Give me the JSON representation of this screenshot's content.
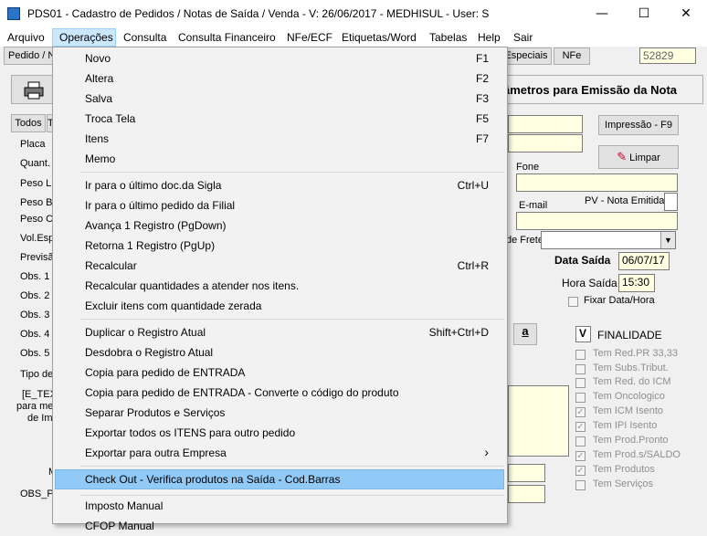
{
  "window": {
    "title": "PDS01 - Cadastro de Pedidos / Notas de Saída / Venda - V: 26/06/2017 - MEDHISUL - User: S",
    "minimize_glyph": "—",
    "maximize_glyph": "☐",
    "close_glyph": "✕"
  },
  "menubar": [
    "Arquivo",
    "Operações",
    "Consulta",
    "Consulta Financeiro",
    "NFe/ECF",
    "Etiquetas/Word",
    "Tabelas",
    "Help",
    "Sair"
  ],
  "form": {
    "tab_pedido": "Pedido / N",
    "btn_especiais": "Especiais",
    "btn_nfe": "NFe",
    "record_number": "52829",
    "banner": "âmetros para Emissão da Nota",
    "btn_todos": "Todos",
    "btn_t": "T",
    "btn_impressao": "Impressão - F9",
    "btn_limpar": "Limpar",
    "left_labels": [
      "Placa",
      "Quant. V",
      "Peso Lí",
      "Peso Br",
      "Peso Cu",
      "Vol.Esp",
      "Previsã",
      "Obs. 1",
      "Obs. 2",
      "Obs. 3",
      "Obs. 4",
      "Obs. 5",
      "Tipo de"
    ],
    "e_text_lines": [
      "[E_TEX",
      "para me",
      "de Imp"
    ],
    "label_m": "M",
    "label_obs_p": "OBS_P",
    "label_fone": "Fone",
    "label_email": "E-mail",
    "label_pv": "PV - Nota Emitida",
    "label_frete": "de Frete",
    "label_data_saida": "Data Saída",
    "data_saida": "06/07/17",
    "label_hora_saida": "Hora Saída",
    "hora_saida": "15:30",
    "label_fixar": "Fixar Data/Hora",
    "finalidade_value": "V",
    "finalidade_label": "FINALIDADE",
    "checkboxes": [
      {
        "label": "Tem Red.PR 33,33",
        "checked": false
      },
      {
        "label": "Tem Subs.Tribut.",
        "checked": false
      },
      {
        "label": "Tem Red. do ICM",
        "checked": false
      },
      {
        "label": "Tem Oncologico",
        "checked": false
      },
      {
        "label": "Tem ICM Isento",
        "checked": true
      },
      {
        "label": "Tem IPI Isento",
        "checked": true
      },
      {
        "label": "Tem Prod.Pronto",
        "checked": false
      },
      {
        "label": "Tem Prod.s/SALDO",
        "checked": true
      },
      {
        "label": "Tem Produtos",
        "checked": true
      },
      {
        "label": "Tem Serviços",
        "checked": false
      }
    ]
  },
  "dropdown": {
    "groups": [
      [
        {
          "label": "Novo",
          "shortcut": "F1"
        },
        {
          "label": "Altera",
          "shortcut": "F2"
        },
        {
          "label": "Salva",
          "shortcut": "F3"
        },
        {
          "label": "Troca Tela",
          "shortcut": "F5"
        },
        {
          "label": "Itens",
          "shortcut": "F7"
        },
        {
          "label": "Memo",
          "shortcut": ""
        }
      ],
      [
        {
          "label": "Ir para o último doc.da Sigla",
          "shortcut": "Ctrl+U"
        },
        {
          "label": "Ir para o último pedido da Filial",
          "shortcut": ""
        },
        {
          "label": "Avança 1 Registro (PgDown)",
          "shortcut": ""
        },
        {
          "label": "Retorna 1 Registro (PgUp)",
          "shortcut": ""
        },
        {
          "label": "Recalcular",
          "shortcut": "Ctrl+R"
        },
        {
          "label": "Recalcular quantidades a atender nos itens.",
          "shortcut": ""
        },
        {
          "label": "Excluir itens com quantidade zerada",
          "shortcut": ""
        }
      ],
      [
        {
          "label": "Duplicar o Registro Atual",
          "shortcut": "Shift+Ctrl+D"
        },
        {
          "label": "Desdobra o Registro Atual",
          "shortcut": ""
        },
        {
          "label": "Copia para pedido de ENTRADA",
          "shortcut": ""
        },
        {
          "label": "Copia para pedido de ENTRADA - Converte o código do produto",
          "shortcut": ""
        },
        {
          "label": "Separar Produtos e Serviços",
          "shortcut": ""
        },
        {
          "label": "Exportar todos os ITENS para outro pedido",
          "shortcut": ""
        },
        {
          "label": "Exportar para outra Empresa",
          "shortcut": "›"
        }
      ],
      [
        {
          "label": "Check Out - Verifica produtos na Saída - Cod.Barras",
          "shortcut": "",
          "highlighted": true
        }
      ],
      [
        {
          "label": "Imposto Manual",
          "shortcut": ""
        },
        {
          "label": "CFOP Manual",
          "shortcut": ""
        }
      ]
    ]
  }
}
